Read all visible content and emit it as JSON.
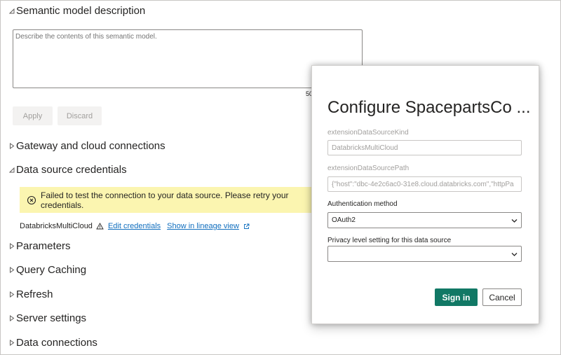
{
  "settings": {
    "semantic_description": {
      "heading": "Semantic model description",
      "placeholder": "Describe the contents of this semantic model.",
      "char_count": "50",
      "apply_label": "Apply",
      "discard_label": "Discard"
    },
    "sections": {
      "gateway": "Gateway and cloud connections",
      "credentials": "Data source credentials",
      "parameters": "Parameters",
      "query_caching": "Query Caching",
      "refresh": "Refresh",
      "server_settings": "Server settings",
      "data_connections": "Data connections"
    },
    "warning_text": "Failed to test the connection to your data source. Please retry your credentials.",
    "credential_row": {
      "source_name": "DatabricksMultiCloud",
      "edit_link": "Edit credentials",
      "lineage_link": "Show in lineage view"
    }
  },
  "dialog": {
    "title": "Configure SpacepartsCo ...",
    "kind_label": "extensionDataSourceKind",
    "kind_value": "DatabricksMultiCloud",
    "path_label": "extensionDataSourcePath",
    "path_value": "{\"host\":\"dbc-4e2c6ac0-31e8.cloud.databricks.com\",\"httpPa",
    "auth_label": "Authentication method",
    "auth_value": "OAuth2",
    "privacy_label": "Privacy level setting for this data source",
    "privacy_value": "",
    "sign_in_label": "Sign in",
    "cancel_label": "Cancel"
  },
  "colors": {
    "primary": "#117865",
    "warning_bg": "#fbf5b0",
    "link": "#106ebe"
  },
  "icons": {
    "expanded": "triangle-expanded-icon",
    "collapsed": "triangle-collapsed-icon",
    "warning": "error-circle-icon",
    "external": "external-link-icon",
    "chevron": "chevron-down-icon"
  }
}
